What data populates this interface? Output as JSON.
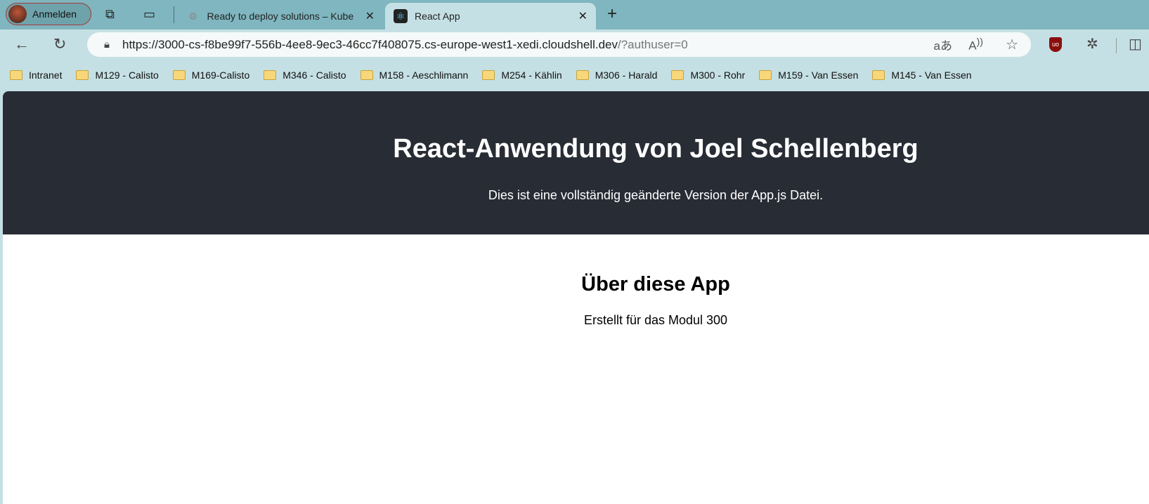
{
  "browser": {
    "profile_label": "Anmelden",
    "tabs": [
      {
        "title": "Ready to deploy solutions – Kube",
        "icon": "gear-favicon",
        "active": false
      },
      {
        "title": "React App",
        "icon": "react-favicon",
        "active": true
      }
    ],
    "url_main": "https://3000-cs-f8be99f7-556b-4ee8-9ec3-46cc7f408075.cs-europe-west1-xedi.cloudshell.dev",
    "url_query": "/?authuser=0",
    "bookmarks": [
      "Intranet",
      "M129 - Calisto",
      "M169-Calisto",
      "M346 - Calisto",
      "M158 - Aeschlimann",
      "M254 - Kählin",
      "M306 - Harald",
      "M300 - Rohr",
      "M159 - Van Essen",
      "M145 - Van Essen"
    ],
    "colors": {
      "tabbar": "#7fb6bf",
      "toolbar": "#c5e0e4"
    }
  },
  "app": {
    "title": "React-Anwendung von Joel Schellenberg",
    "subtitle": "Dies ist eine vollständig geänderte Version der App.js Datei.",
    "section_title": "Über diese App",
    "section_text": "Erstellt für das Modul 300",
    "colors": {
      "header_bg": "#282c34"
    }
  }
}
